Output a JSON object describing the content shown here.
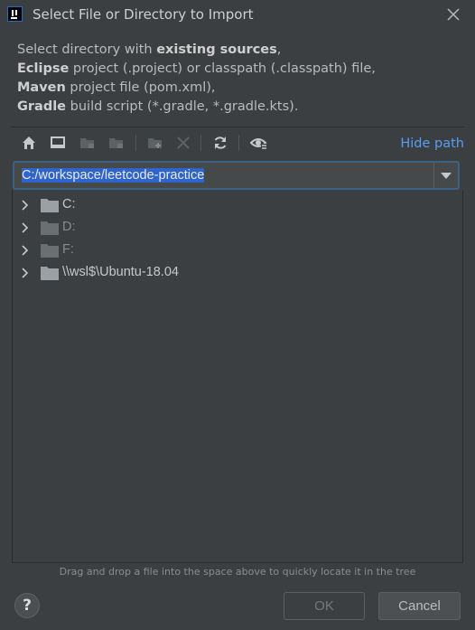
{
  "window": {
    "title": "Select File or Directory to Import"
  },
  "description": {
    "line1_pre": "Select directory with ",
    "line1_bold": "existing sources",
    "line1_post": ",",
    "line2_bold": "Eclipse",
    "line2_post": " project (.project) or classpath (.classpath) file,",
    "line3_bold": "Maven",
    "line3_post": " project file (pom.xml),",
    "line4_bold": "Gradle",
    "line4_post": " build script (*.gradle, *.gradle.kts)."
  },
  "toolbar": {
    "icons": [
      "home-icon",
      "desktop-icon",
      "project-folder-icon",
      "module-folder-icon",
      "new-folder-icon",
      "delete-icon",
      "refresh-icon",
      "show-hidden-icon"
    ],
    "hide_path_label": "Hide path"
  },
  "path": {
    "value": "C:/workspace/leetcode-practice"
  },
  "tree": {
    "items": [
      {
        "label": "C:",
        "enabled": true
      },
      {
        "label": "D:",
        "enabled": false
      },
      {
        "label": "F:",
        "enabled": false
      },
      {
        "label": "\\\\wsl$\\Ubuntu-18.04",
        "enabled": true
      }
    ]
  },
  "hint": "Drag and drop a file into the space above to quickly locate it in the tree",
  "buttons": {
    "help_label": "?",
    "ok_label": "OK",
    "cancel_label": "Cancel"
  },
  "colors": {
    "background": "#3c3f41",
    "accent_link": "#589df6",
    "selection": "#2f65ca",
    "focus_border": "#3d6185"
  }
}
